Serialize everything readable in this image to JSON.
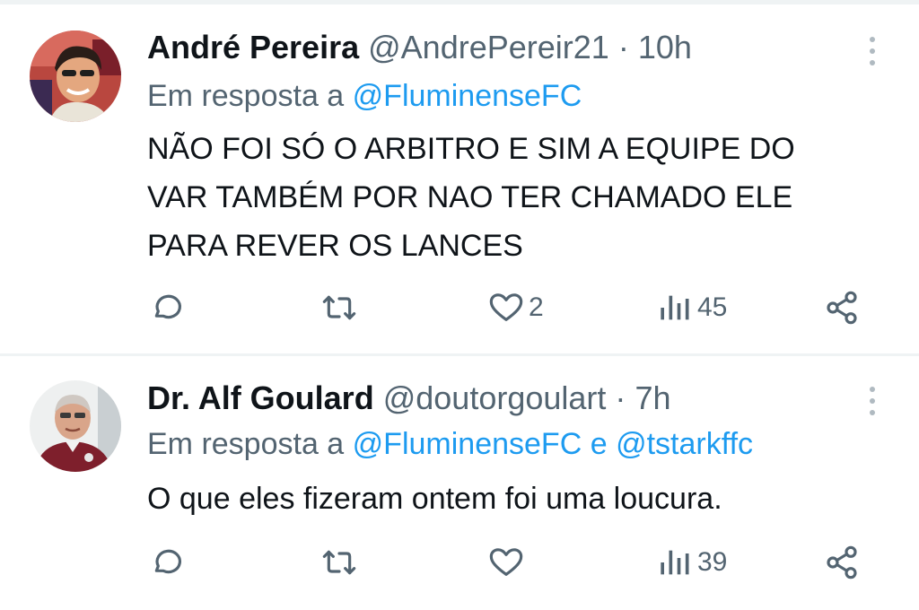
{
  "tweets": [
    {
      "name": "André Pereira",
      "handle": "@AndrePereir21",
      "separator": "·",
      "time": "10h",
      "reply_prefix": "Em resposta a",
      "reply_mentions": [
        "@FluminenseFC"
      ],
      "reply_joiner": "",
      "body_lines": [
        "NÃO FOI SÓ O ARBITRO E SIM A EQUIPE DO",
        "VAR TAMBÉM POR NAO TER CHAMADO ELE",
        "PARA REVER OS LANCES"
      ],
      "likes": "2",
      "views": "45"
    },
    {
      "name": "Dr. Alf Goulard",
      "handle": "@doutorgoulart",
      "separator": "·",
      "time": "7h",
      "reply_prefix": "Em resposta a",
      "reply_mentions": [
        "@FluminenseFC",
        "@tstarkffc"
      ],
      "reply_joiner": "e",
      "body_lines": [
        "O que eles fizeram ontem foi uma loucura."
      ],
      "likes": "",
      "views": "39"
    }
  ],
  "icons": {
    "reply": "reply-icon",
    "retweet": "retweet-icon",
    "like": "heart-icon",
    "views": "views-icon",
    "share": "share-icon",
    "more": "more-icon"
  },
  "colors": {
    "link": "#1d9bf0",
    "secondary_text": "#536471",
    "primary_text": "#0f1419",
    "divider": "#eff3f4"
  }
}
